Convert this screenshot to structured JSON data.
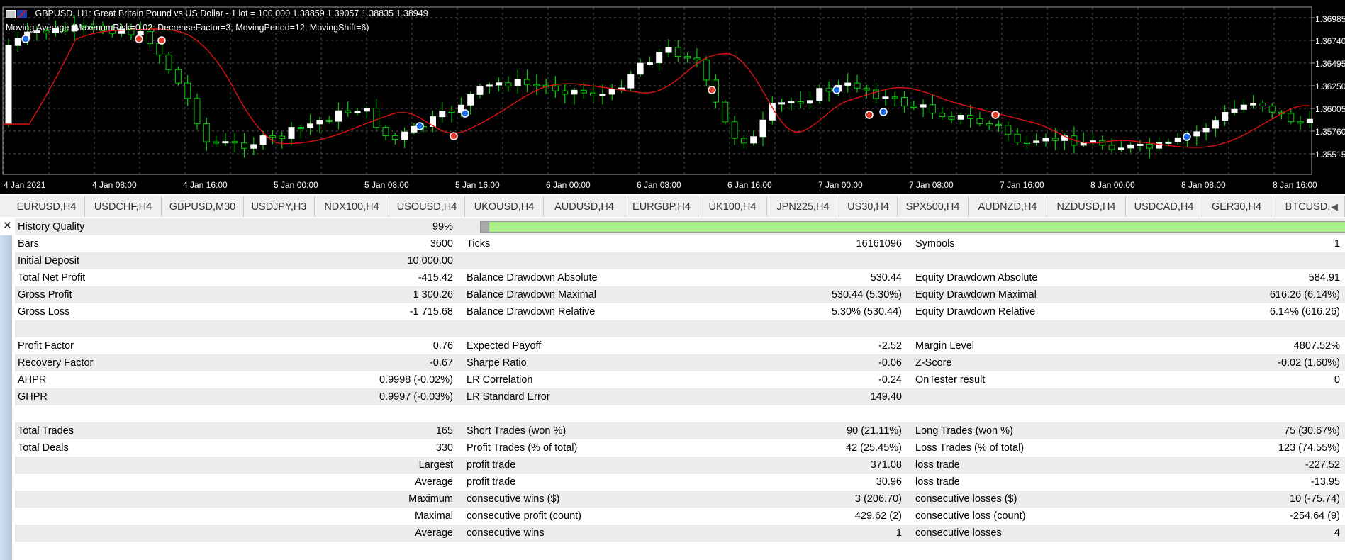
{
  "chart": {
    "title": "GBPUSD, H1:  Great Britain Pound vs US Dollar - 1 lot = 100,000  1.38859 1.39057 1.38835 1.38949",
    "indicator": "Moving Average (MaximumRisk=0.02; DecreaseFactor=3; MovingPeriod=12; MovingShift=6)",
    "price_levels": [
      "1.36985",
      "1.36740",
      "1.36495",
      "1.36250",
      "1.36005",
      "1.35760",
      "1.35515"
    ],
    "time_labels": [
      "4 Jan 2021",
      "4 Jan 08:00",
      "4 Jan 16:00",
      "5 Jan 00:00",
      "5 Jan 08:00",
      "5 Jan 16:00",
      "6 Jan 00:00",
      "6 Jan 08:00",
      "6 Jan 16:00",
      "7 Jan 00:00",
      "7 Jan 08:00",
      "7 Jan 16:00",
      "8 Jan 00:00",
      "8 Jan 08:00",
      "8 Jan 16:00"
    ],
    "colors": {
      "background": "#000000",
      "bull_candle": "#ffffff",
      "bear_candle": "#000000",
      "wick": "#00d000",
      "moving_average": "#e01010",
      "grid": "#555555"
    }
  },
  "tabs": [
    "EURUSD,H4",
    "USDCHF,H4",
    "GBPUSD,M30",
    "USDJPY,H3",
    "NDX100,H4",
    "USOUSD,H4",
    "UKOUSD,H4",
    "AUDUSD,H4",
    "EURGBP,H4",
    "UK100,H4",
    "JPN225,H4",
    "US30,H4",
    "SPX500,H4",
    "AUDNZD,H4",
    "NZDUSD,H4",
    "USDCAD,H4",
    "GER30,H4",
    "BTCUSD,"
  ],
  "tab_scroll_icon": "chevron-left-icon",
  "report": {
    "history_quality": {
      "label": "History Quality",
      "value": "99%",
      "fraction": 0.99
    },
    "rows": [
      {
        "l1": "Bars",
        "v1": "3600",
        "l2": "Ticks",
        "v2": "16161096",
        "l3": "Symbols",
        "v3": "1"
      },
      {
        "l1": "Initial Deposit",
        "v1": "10 000.00",
        "l2": "",
        "v2": "",
        "l3": "",
        "v3": ""
      },
      {
        "l1": "Total Net Profit",
        "v1": "-415.42",
        "l2": "Balance Drawdown Absolute",
        "v2": "530.44",
        "l3": "Equity Drawdown Absolute",
        "v3": "584.91"
      },
      {
        "l1": "Gross Profit",
        "v1": "1 300.26",
        "l2": "Balance Drawdown Maximal",
        "v2": "530.44 (5.30%)",
        "l3": "Equity Drawdown Maximal",
        "v3": "616.26 (6.14%)"
      },
      {
        "l1": "Gross Loss",
        "v1": "-1 715.68",
        "l2": "Balance Drawdown Relative",
        "v2": "5.30% (530.44)",
        "l3": "Equity Drawdown Relative",
        "v3": "6.14% (616.26)"
      },
      {
        "l1": "",
        "v1": "",
        "l2": "",
        "v2": "",
        "l3": "",
        "v3": ""
      },
      {
        "l1": "Profit Factor",
        "v1": "0.76",
        "l2": "Expected Payoff",
        "v2": "-2.52",
        "l3": "Margin Level",
        "v3": "4807.52%"
      },
      {
        "l1": "Recovery Factor",
        "v1": "-0.67",
        "l2": "Sharpe Ratio",
        "v2": "-0.06",
        "l3": "Z-Score",
        "v3": "-0.02 (1.60%)"
      },
      {
        "l1": "AHPR",
        "v1": "0.9998 (-0.02%)",
        "l2": "LR Correlation",
        "v2": "-0.24",
        "l3": "OnTester result",
        "v3": "0"
      },
      {
        "l1": "GHPR",
        "v1": "0.9997 (-0.03%)",
        "l2": "LR Standard Error",
        "v2": "149.40",
        "l3": "",
        "v3": ""
      },
      {
        "l1": "",
        "v1": "",
        "l2": "",
        "v2": "",
        "l3": "",
        "v3": ""
      },
      {
        "l1": "Total Trades",
        "v1": "165",
        "l2": "Short Trades (won %)",
        "v2": "90 (21.11%)",
        "l3": "Long Trades (won %)",
        "v3": "75 (30.67%)"
      },
      {
        "l1": "Total Deals",
        "v1": "330",
        "l2": "Profit Trades (% of total)",
        "v2": "42 (25.45%)",
        "l3": "Loss Trades (% of total)",
        "v3": "123 (74.55%)"
      },
      {
        "l1": "",
        "v1": "Largest",
        "l2": "profit trade",
        "v2": "371.08",
        "l3": "loss trade",
        "v3": "-227.52"
      },
      {
        "l1": "",
        "v1": "Average",
        "l2": "profit trade",
        "v2": "30.96",
        "l3": "loss trade",
        "v3": "-13.95"
      },
      {
        "l1": "",
        "v1": "Maximum",
        "l2": "consecutive wins ($)",
        "v2": "3 (206.70)",
        "l3": "consecutive losses ($)",
        "v3": "10 (-75.74)"
      },
      {
        "l1": "",
        "v1": "Maximal",
        "l2": "consecutive profit (count)",
        "v2": "429.62 (2)",
        "l3": "consecutive loss (count)",
        "v3": "-254.64 (9)"
      },
      {
        "l1": "",
        "v1": "Average",
        "l2": "consecutive wins",
        "v2": "1",
        "l3": "consecutive losses",
        "v3": "4"
      },
      {
        "l1": "",
        "v1": "",
        "l2": "",
        "v2": "",
        "l3": "",
        "v3": ""
      }
    ]
  }
}
